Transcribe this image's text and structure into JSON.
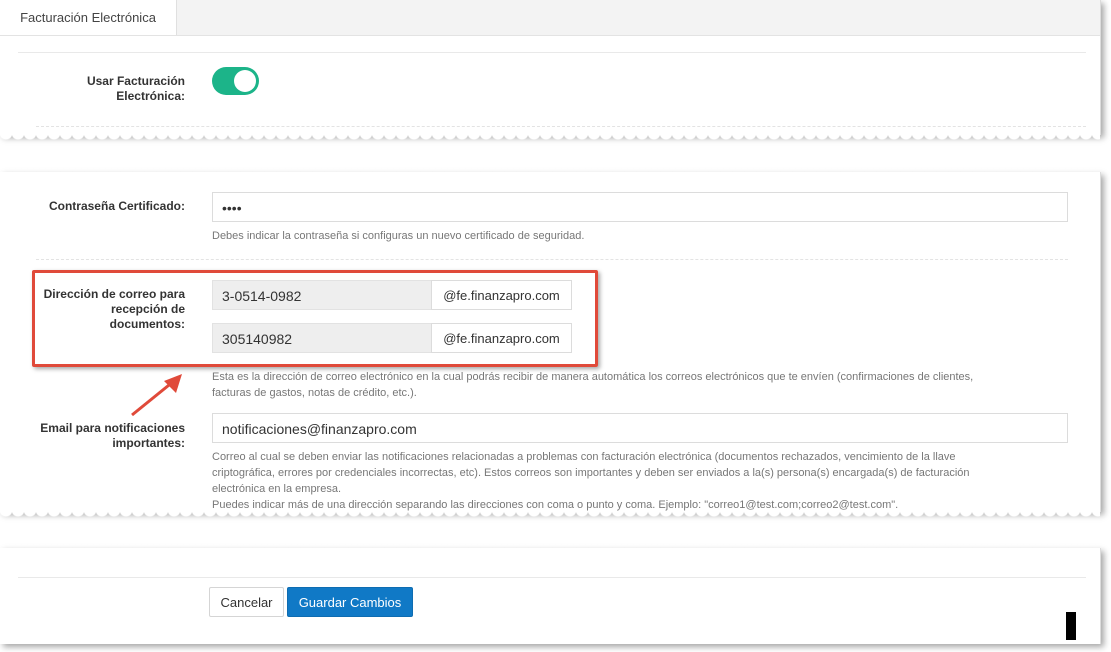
{
  "tab": {
    "label": "Facturación Electrónica"
  },
  "toggle": {
    "label_line1": "Usar Facturación",
    "label_line2": "Electrónica:",
    "checked": true,
    "color": "#1cb489"
  },
  "certificate": {
    "label": "Contraseña Certificado:",
    "value": "••••",
    "help": "Debes indicar la contraseña si configuras un nuevo certificado de seguridad."
  },
  "reception_email": {
    "label_line1": "Dirección de correo para",
    "label_line2": "recepción de",
    "label_line3": "documentos:",
    "rows": [
      {
        "value": "3-0514-0982",
        "domain": "@fe.finanzapro.com"
      },
      {
        "value": "305140982",
        "domain": "@fe.finanzapro.com"
      }
    ],
    "help_line1": "Esta es la dirección de correo electrónico en la cual podrás recibir de manera automática los correos electrónicos que te envíen (confirmaciones de clientes,",
    "help_line2": "facturas de gastos, notas de crédito, etc.)."
  },
  "notifications": {
    "label_line1": "Email para notificaciones",
    "label_line2": "importantes:",
    "value": "notificaciones@finanzapro.com",
    "help_line1": "Correo al cual se deben enviar las notificaciones relacionadas a problemas con facturación electrónica (documentos rechazados, vencimiento de la llave",
    "help_line2": "criptográfica, errores por credenciales incorrectas, etc). Estos correos son importantes y deben ser enviados a la(s) persona(s) encargada(s) de facturación",
    "help_line3": "electrónica en la empresa.",
    "help_line4": "Puedes indicar más de una dirección separando las direcciones con coma o punto y coma. Ejemplo: \"correo1@test.com;correo2@test.com\"."
  },
  "actions": {
    "cancel": "Cancelar",
    "save": "Guardar Cambios",
    "save_color": "#1079c6"
  },
  "annotation": {
    "highlight_color": "#e04a3a"
  }
}
